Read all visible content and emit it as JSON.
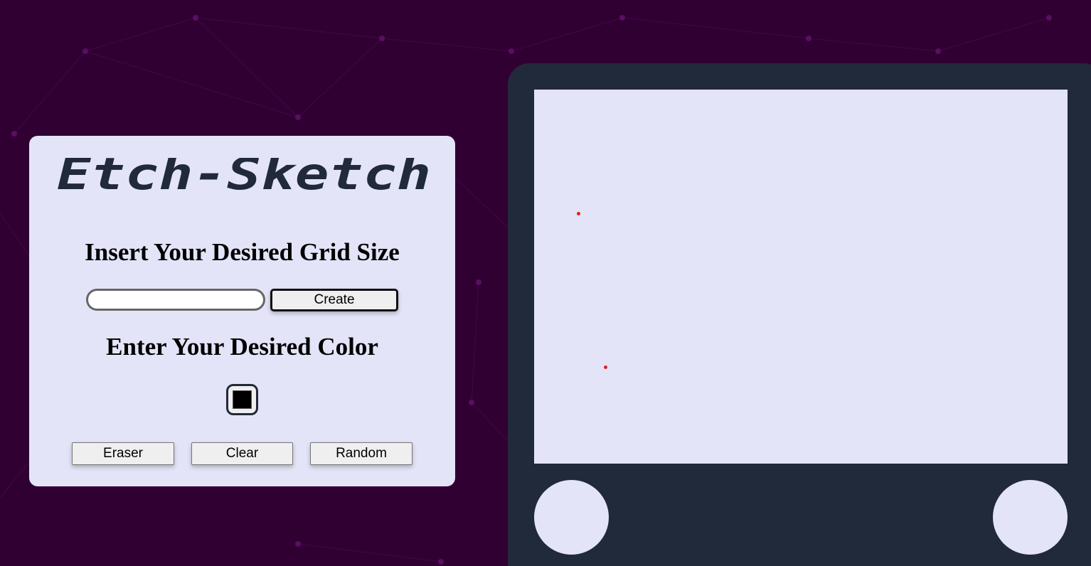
{
  "app": {
    "title": "Etch-Sketch"
  },
  "controls": {
    "grid_heading": "Insert Your Desired Grid Size",
    "grid_input_value": "",
    "create_label": "Create",
    "color_heading": "Enter Your Desired Color",
    "color_value": "#000000",
    "eraser_label": "Eraser",
    "clear_label": "Clear",
    "random_label": "Random"
  },
  "colors": {
    "background": "#300033",
    "panel": "#e4e4f8",
    "device": "#212a3a",
    "logo": "#212a3a",
    "ink": "#e02020"
  },
  "icons": {
    "color_picker": "color-swatch-icon",
    "knobs": "knob-circle"
  }
}
